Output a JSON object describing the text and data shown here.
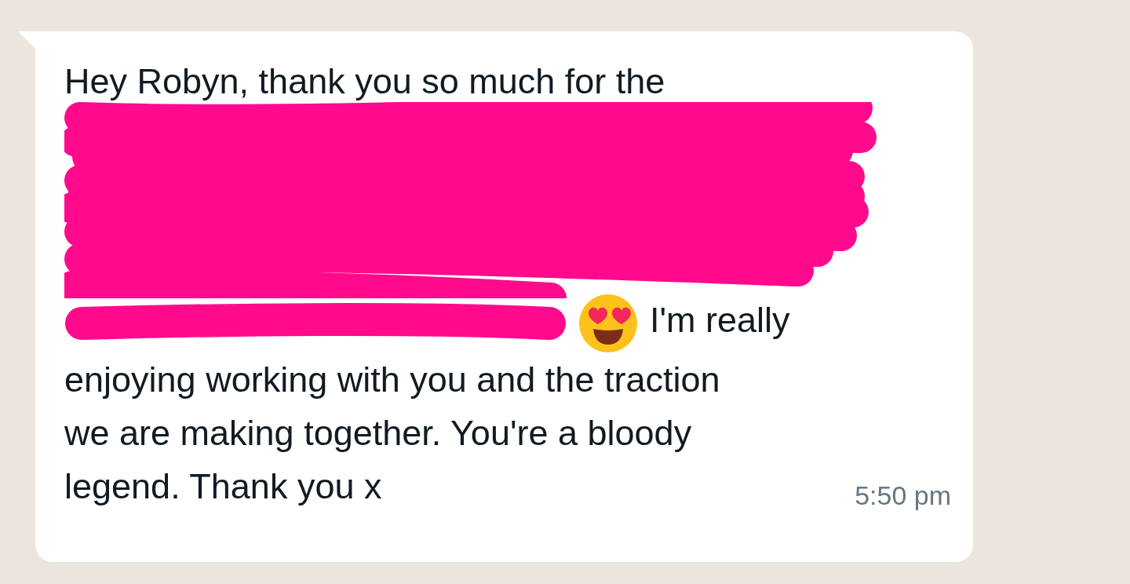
{
  "message": {
    "text_before": "Hey Robyn, thank you so much for the",
    "redacted": true,
    "text_after_emoji": "I'm really",
    "lines": [
      "enjoying working with you and the traction",
      "we are making together. You're a bloody",
      "legend. Thank you x"
    ],
    "time": "5:50 pm"
  }
}
